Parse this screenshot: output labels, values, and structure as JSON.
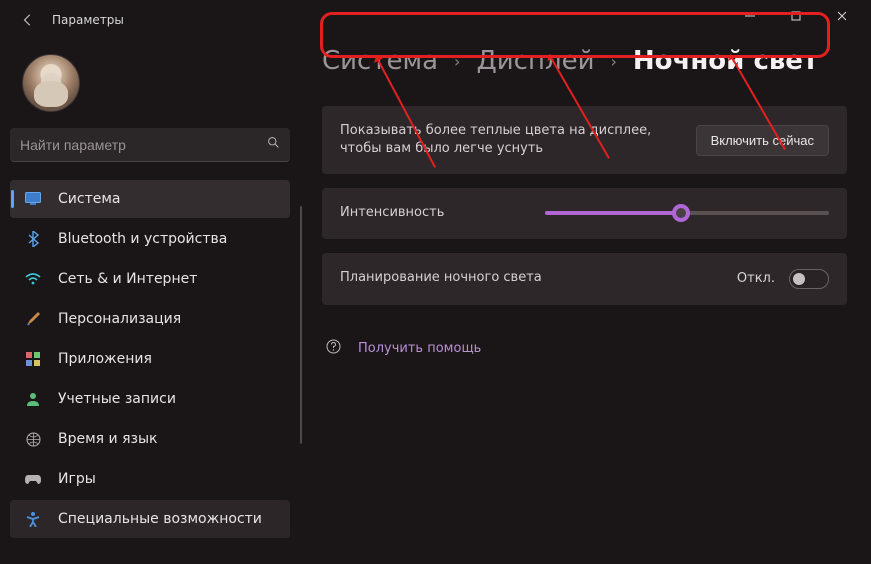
{
  "window": {
    "title": "Параметры"
  },
  "search": {
    "placeholder": "Найти параметр"
  },
  "sidebar": {
    "items": [
      {
        "label": "Система",
        "icon": "monitor",
        "active": true
      },
      {
        "label": "Bluetooth и устройства",
        "icon": "bluetooth"
      },
      {
        "label": "Сеть & и Интернет",
        "icon": "wifi"
      },
      {
        "label": "Персонализация",
        "icon": "brush"
      },
      {
        "label": "Приложения",
        "icon": "apps"
      },
      {
        "label": "Учетные записи",
        "icon": "person"
      },
      {
        "label": "Время и язык",
        "icon": "clock-globe"
      },
      {
        "label": "Игры",
        "icon": "gamepad"
      },
      {
        "label": "Специальные возможности",
        "icon": "accessibility",
        "alt_active": true
      }
    ]
  },
  "breadcrumb": {
    "items": [
      "Система",
      "Дисплей",
      "Ночной свет"
    ]
  },
  "night_light": {
    "description": "Показывать более теплые цвета на дисплее, чтобы вам было легче уснуть",
    "turn_on_label": "Включить сейчас",
    "intensity_label": "Интенсивность",
    "intensity_percent": 48,
    "schedule_label": "Планирование ночного света",
    "schedule_state": "Откл."
  },
  "help": {
    "label": "Получить помощь"
  },
  "colors": {
    "accent": "#b066d6",
    "annotation": "#e22020"
  }
}
